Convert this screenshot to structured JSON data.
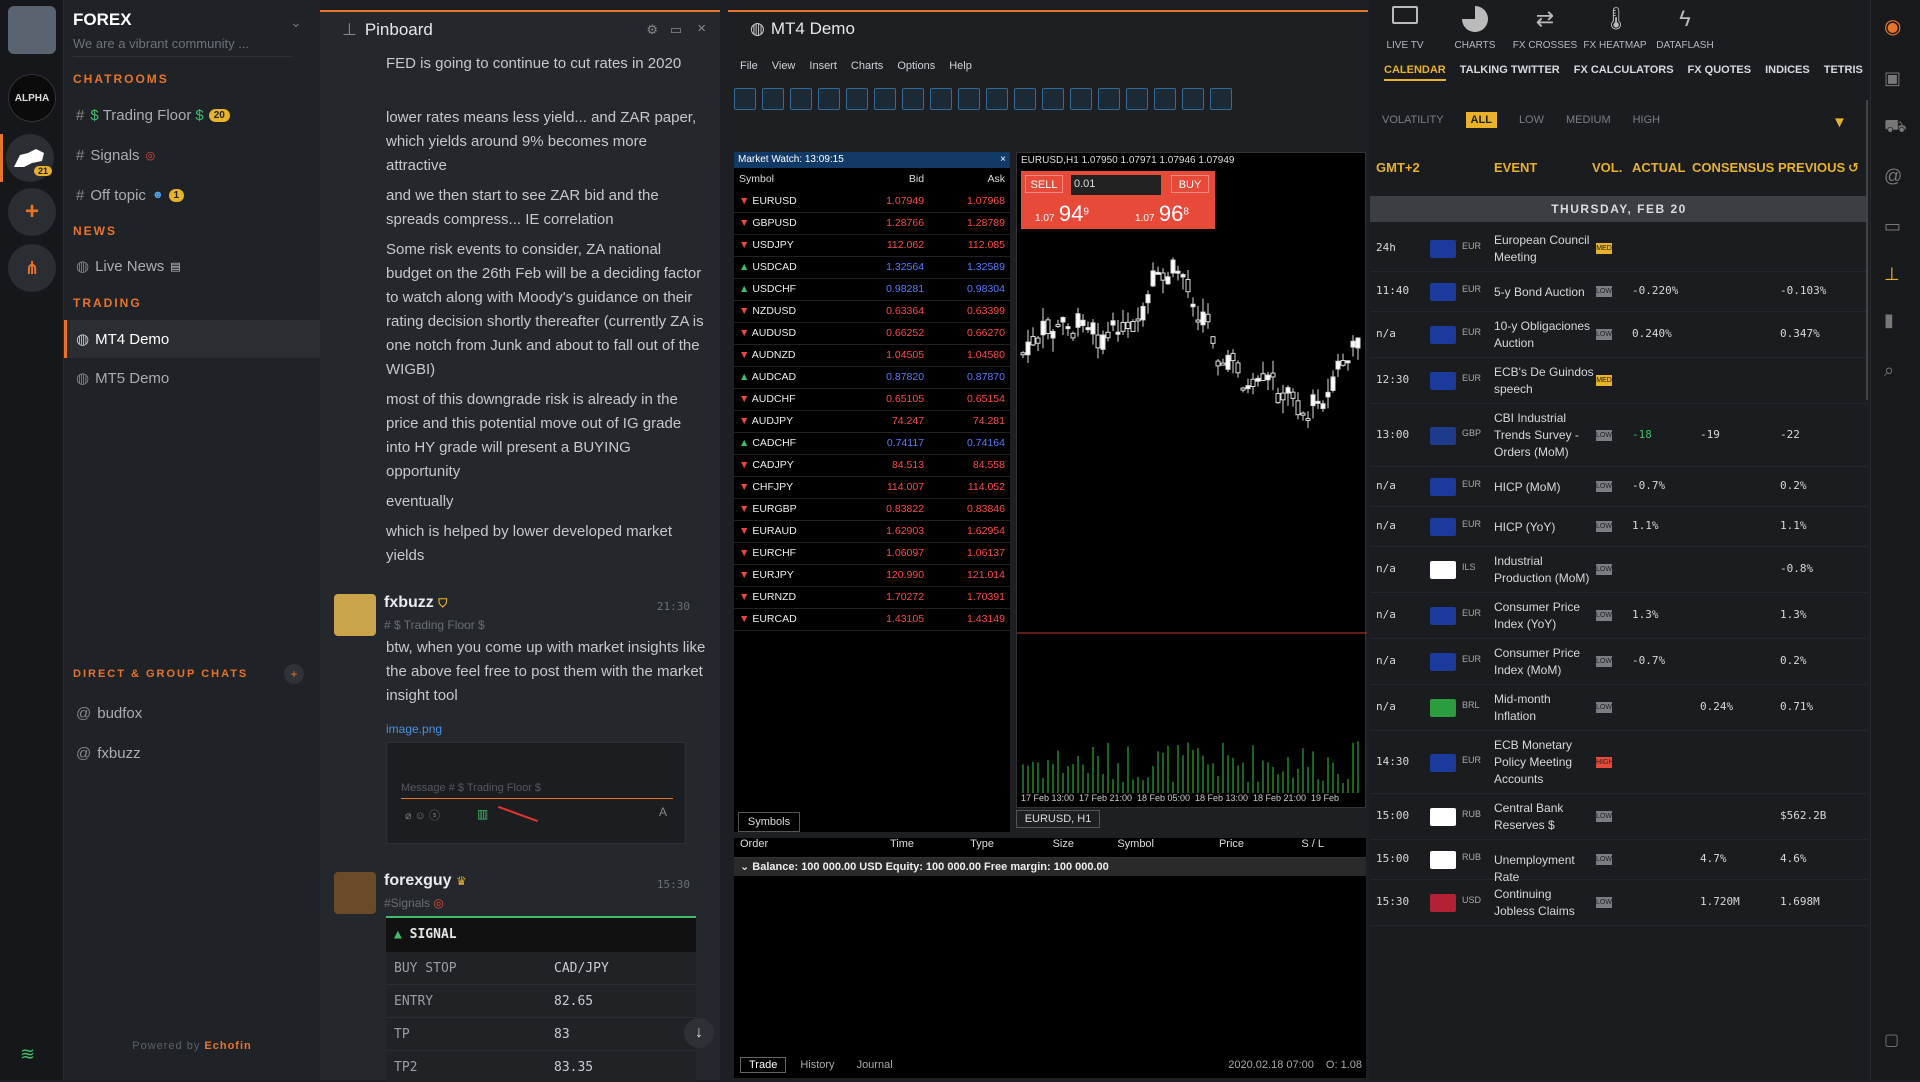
{
  "server": {
    "title": "FOREX",
    "subtitle": "We are a vibrant community ...",
    "alpha_label": "ALPHA",
    "bull_badge": "21"
  },
  "sidebar": {
    "chatrooms_label": "CHATROOMS",
    "chatrooms": [
      {
        "label": "Trading Floor",
        "badge": "20"
      },
      {
        "label": "Signals"
      },
      {
        "label": "Off topic",
        "badge": "1"
      }
    ],
    "news_label": "NEWS",
    "news": [
      {
        "label": "Live News"
      }
    ],
    "trading_label": "TRADING",
    "trading": [
      {
        "label": "MT4 Demo"
      },
      {
        "label": "MT5 Demo"
      }
    ],
    "direct_label": "DIRECT & GROUP CHATS",
    "direct": [
      {
        "label": "budfox"
      },
      {
        "label": "fxbuzz"
      }
    ],
    "powered": "Powered by",
    "powered_brand": "Echofin"
  },
  "pinboard": {
    "title": "Pinboard",
    "messages": [
      "FED is going to continue to cut rates in 2020",
      "lower rates means less yield... and ZAR paper, which yields around 9% becomes more attractive",
      "and we then start to see ZAR bid and the spreads compress... IE correlation",
      "Some risk events to consider, ZA national budget on the 26th Feb will be a deciding factor to watch along with Moody's guidance on their rating decision shortly thereafter (currently ZA is one notch from Junk and about to fall out of the WIGBI)",
      "most of this downgrade risk is already in the price and this potential move out of IG grade into HY grade will present a BUYING opportunity",
      "eventually",
      "which is helped by lower developed market yields"
    ],
    "post1": {
      "user": "fxbuzz",
      "time": "21:30",
      "channel": "# $ Trading Floor $",
      "text": "btw, when you come up with market insights like the above feel free to post them with the market insight tool",
      "link": "image.png",
      "placeholder": "Message # $ Trading Floor $"
    },
    "post2": {
      "user": "forexguy",
      "time": "15:30",
      "channel": "#Signals",
      "signal_title": "SIGNAL",
      "rows": [
        {
          "k": "BUY STOP",
          "v": "CAD/JPY"
        },
        {
          "k": "ENTRY",
          "v": "82.65"
        },
        {
          "k": "TP",
          "v": "83"
        },
        {
          "k": "TP2",
          "v": "83.35"
        }
      ]
    }
  },
  "mt4": {
    "title": "MT4 Demo",
    "menu": [
      "File",
      "View",
      "Insert",
      "Charts",
      "Options",
      "Help"
    ],
    "market_watch": "Market Watch: 13:09:15",
    "cols": [
      "Symbol",
      "Bid",
      "Ask"
    ],
    "rows": [
      {
        "s": "EURUSD",
        "b": "1.07949",
        "a": "1.07968",
        "up": false
      },
      {
        "s": "GBPUSD",
        "b": "1.28766",
        "a": "1.28789",
        "up": false
      },
      {
        "s": "USDJPY",
        "b": "112.062",
        "a": "112.085",
        "up": false
      },
      {
        "s": "USDCAD",
        "b": "1.32564",
        "a": "1.32589",
        "up": true
      },
      {
        "s": "USDCHF",
        "b": "0.98281",
        "a": "0.98304",
        "up": true
      },
      {
        "s": "NZDUSD",
        "b": "0.63364",
        "a": "0.63399",
        "up": false
      },
      {
        "s": "AUDUSD",
        "b": "0.66252",
        "a": "0.66270",
        "up": false
      },
      {
        "s": "AUDNZD",
        "b": "1.04505",
        "a": "1.04580",
        "up": false
      },
      {
        "s": "AUDCAD",
        "b": "0.87820",
        "a": "0.87870",
        "up": true
      },
      {
        "s": "AUDCHF",
        "b": "0.65105",
        "a": "0.65154",
        "up": false
      },
      {
        "s": "AUDJPY",
        "b": "74.247",
        "a": "74.281",
        "up": false
      },
      {
        "s": "CADCHF",
        "b": "0.74117",
        "a": "0.74164",
        "up": true
      },
      {
        "s": "CADJPY",
        "b": "84.513",
        "a": "84.558",
        "up": false
      },
      {
        "s": "CHFJPY",
        "b": "114.007",
        "a": "114.052",
        "up": false
      },
      {
        "s": "EURGBP",
        "b": "0.83822",
        "a": "0.83846",
        "up": false
      },
      {
        "s": "EURAUD",
        "b": "1.62903",
        "a": "1.62954",
        "up": false
      },
      {
        "s": "EURCHF",
        "b": "1.06097",
        "a": "1.06137",
        "up": false
      },
      {
        "s": "EURJPY",
        "b": "120.990",
        "a": "121.014",
        "up": false
      },
      {
        "s": "EURNZD",
        "b": "1.70272",
        "a": "1.70391",
        "up": false
      },
      {
        "s": "EURCAD",
        "b": "1.43105",
        "a": "1.43149",
        "up": false
      }
    ],
    "symbols_tab": "Symbols",
    "chart_header": "EURUSD,H1  1.07950 1.07971 1.07946 1.07949",
    "sell": "SELL",
    "buy": "BUY",
    "lot": "0.01",
    "sell_price_pre": "1.07",
    "sell_price": "94",
    "sell_sup": "9",
    "buy_price_pre": "1.07",
    "buy_price": "96",
    "buy_sup": "8",
    "xticks": [
      "17 Feb 13:00",
      "17 Feb 21:00",
      "18 Feb 05:00",
      "18 Feb 13:00",
      "18 Feb 21:00",
      "19 Feb"
    ],
    "chart_tab": "EURUSD, H1",
    "term_cols": [
      "Order",
      "Time",
      "Type",
      "Size",
      "Symbol",
      "Price",
      "S / L"
    ],
    "balance": "Balance: 100 000.00 USD  Equity: 100 000.00  Free margin: 100 000.00",
    "term_tabs": [
      "Trade",
      "History",
      "Journal"
    ],
    "status_time": "2020.02.18 07:00",
    "status_o": "O: 1.08"
  },
  "calendar": {
    "top": [
      "LIVE TV",
      "CHARTS",
      "FX CROSSES",
      "FX HEATMAP",
      "DATAFLASH"
    ],
    "tabs": [
      "CALENDAR",
      "TALKING TWITTER",
      "FX CALCULATORS",
      "FX QUOTES",
      "INDICES",
      "TETRIS"
    ],
    "vol_label": "VOLATILITY",
    "vol": [
      "ALL",
      "LOW",
      "MEDIUM",
      "HIGH"
    ],
    "cols": [
      "GMT+2",
      "EVENT",
      "VOL.",
      "ACTUAL",
      "CONSENSUS",
      "PREVIOUS"
    ],
    "day": "THURSDAY, FEB 20",
    "events": [
      {
        "t": "24h",
        "c": "EUR",
        "e": "European Council Meeting",
        "v": "MED",
        "a": "",
        "cs": "",
        "p": ""
      },
      {
        "t": "11:40",
        "c": "EUR",
        "e": "5-y Bond Auction",
        "v": "LOW",
        "a": "-0.220%",
        "cs": "",
        "p": "-0.103%"
      },
      {
        "t": "n/a",
        "c": "EUR",
        "e": "10-y Obligaciones Auction",
        "v": "LOW",
        "a": "0.240%",
        "cs": "",
        "p": "0.347%"
      },
      {
        "t": "12:30",
        "c": "EUR",
        "e": "ECB's De Guindos speech",
        "v": "MED",
        "a": "",
        "cs": "",
        "p": ""
      },
      {
        "t": "13:00",
        "c": "GBP",
        "e": "CBI Industrial Trends Survey - Orders (MoM)",
        "v": "LOW",
        "a": "-18",
        "cs": "-19",
        "p": "-22"
      },
      {
        "t": "n/a",
        "c": "EUR",
        "e": "HICP (MoM)",
        "v": "LOW",
        "a": "-0.7%",
        "cs": "",
        "p": "0.2%"
      },
      {
        "t": "n/a",
        "c": "EUR",
        "e": "HICP (YoY)",
        "v": "LOW",
        "a": "1.1%",
        "cs": "",
        "p": "1.1%"
      },
      {
        "t": "n/a",
        "c": "ILS",
        "e": "Industrial Production (MoM)",
        "v": "LOW",
        "a": "",
        "cs": "",
        "p": "-0.8%"
      },
      {
        "t": "n/a",
        "c": "EUR",
        "e": "Consumer Price Index (YoY)",
        "v": "LOW",
        "a": "1.3%",
        "cs": "",
        "p": "1.3%"
      },
      {
        "t": "n/a",
        "c": "EUR",
        "e": "Consumer Price Index (MoM)",
        "v": "LOW",
        "a": "-0.7%",
        "cs": "",
        "p": "0.2%"
      },
      {
        "t": "n/a",
        "c": "BRL",
        "e": "Mid-month Inflation",
        "v": "LOW",
        "a": "",
        "cs": "0.24%",
        "p": "0.71%"
      },
      {
        "t": "14:30",
        "c": "EUR",
        "e": "ECB Monetary Policy Meeting Accounts",
        "v": "HIGH",
        "a": "",
        "cs": "",
        "p": ""
      },
      {
        "t": "15:00",
        "c": "RUB",
        "e": "Central Bank Reserves $",
        "v": "LOW",
        "a": "",
        "cs": "",
        "p": "$562.2B"
      },
      {
        "t": "15:00",
        "c": "RUB",
        "e": "Unemployment Rate",
        "v": "LOW",
        "a": "",
        "cs": "4.7%",
        "p": "4.6%"
      },
      {
        "t": "15:30",
        "c": "USD",
        "e": "Continuing Jobless Claims",
        "v": "LOW",
        "a": "",
        "cs": "1.720M",
        "p": "1.698M"
      }
    ]
  }
}
